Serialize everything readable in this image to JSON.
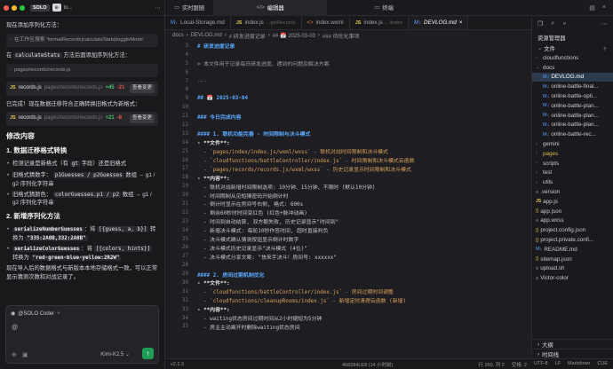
{
  "left_panel": {
    "header_title": "to...",
    "brand": "SOLO",
    "brand_icon": "⊕",
    "intro": "现在添加序列化方法：",
    "fileref1": "在工作区搜索 'formatRecords|calculateStats|toggleMode'",
    "intro2_a": "在 ",
    "intro2_code": "calculateStats",
    "intro2_b": " 方法后面添加序列化方法：",
    "fileref2": "pages/records/records.js",
    "edit1": {
      "file": "records.js",
      "path": "pages/records/records.js",
      "add": "+45",
      "del": "-21",
      "btn": "查看变更"
    },
    "edit2": {
      "file": "records.js",
      "path": "pages/records/records.js",
      "add": "+21",
      "del": "-8",
      "btn": "查看变更"
    },
    "done_text": "已完成！现在数据迁移符合正确转换旧格式为新格式：",
    "h_changes": "修改内容",
    "h1": "1. 数据迁移格式转换",
    "s1": [
      {
        "a": "检测记录是新格式（有 ",
        "code": "gt",
        "b": " 字段）还是旧格式"
      },
      {
        "a": "旧格式猜数字： ",
        "code": "p1Guesses / p2Guesses",
        "b": " 数组 → g1 / g2 序列化字符串"
      },
      {
        "a": "旧格式猜颜色： ",
        "code": "colorGuesses.p1 / p2",
        "b": " 数组 → g1 / g2 序列化字符串"
      }
    ],
    "h2": "2. 新增序列化方法",
    "s2": [
      {
        "code": "serializeNumberGuesses",
        "a": "：将 ",
        "code2": "[{guess, a, b}]",
        "b": " 转换为 ",
        "code3": "\"335:2A0B,332:2A0B\""
      },
      {
        "code": "serializeColorGuesses",
        "a": "：将 ",
        "code2": "[{colors, hints}]",
        "b": " 转换为 ",
        "code3": "\"red-green-blue-yellow:2R2W\""
      }
    ],
    "closing": "现在导入后的数据格式与新版本本地存储格式一致，可以正常显示猜测次数和对战记录了。",
    "composer": {
      "agent": "@SOLO Coder",
      "input": "@",
      "model": "Kimi-K2.5",
      "send": "↑"
    }
  },
  "topbar": {
    "tab_realtime": "实时跟随",
    "tab_editor": "编辑器",
    "tab_terminal": "终端"
  },
  "editor": {
    "tabs": [
      {
        "icon": "md",
        "name": "Local-Storage.md",
        "hint": ""
      },
      {
        "icon": "js",
        "name": "index.js",
        "hint": "...ge\\Records"
      },
      {
        "icon": "xml",
        "name": "index.wxml",
        "hint": ""
      },
      {
        "icon": "js",
        "name": "index.js",
        "hint": "...\\index"
      },
      {
        "icon": "md",
        "name": "DEVLOG.md",
        "hint": ""
      }
    ],
    "breadcrumbs": [
      "docs",
      "DEVLOG.md",
      "# 研发进度记录",
      "## 📅 2025-03-03",
      "### 待优化事项"
    ]
  },
  "code_lines": [
    {
      "n": "3",
      "t": "# 研发进度记录",
      "k": "h"
    },
    {
      "n": "4",
      "t": "",
      "k": ""
    },
    {
      "n": "5",
      "t": "> 本文件用于记录每日研发进度、遇到的问题及解决方案",
      "k": "q"
    },
    {
      "n": "6",
      "t": "",
      "k": ""
    },
    {
      "n": "7",
      "t": "---",
      "k": "q"
    },
    {
      "n": "8",
      "t": "",
      "k": ""
    },
    {
      "n": "9",
      "t": "## 📅 2025-03-04",
      "k": "h"
    },
    {
      "n": "10",
      "t": "",
      "k": ""
    },
    {
      "n": "11",
      "t": "### 今日完成内容",
      "k": "h"
    },
    {
      "n": "12",
      "t": "",
      "k": ""
    },
    {
      "n": "13",
      "t": "#### 1. 联机功能完善 - 时间限制与决斗模式",
      "k": "h"
    },
    {
      "n": "14",
      "t": "- **文件**:",
      "k": "b"
    },
    {
      "n": "15",
      "t": "  - `pages/index/index.js/wxml/wxss` - 联机对战时间限制和决斗模式",
      "k": "c"
    },
    {
      "n": "16",
      "t": "  - `cloudfunctions/battleController/index.js` - 时间限制和决斗模式云函数",
      "k": "c"
    },
    {
      "n": "17",
      "t": "  - `pages/records/records.js/wxml/wxss` - 历史记录显示时间限制和决斗模式",
      "k": "c"
    },
    {
      "n": "18",
      "t": "- **内容**:",
      "k": "b"
    },
    {
      "n": "19",
      "t": "  - 联机对战新增时间限制选项: 10分钟、15分钟、不限时 (默认10分钟)",
      "k": ""
    },
    {
      "n": "20",
      "t": "  - 时间限制从见短猜密码开始倒计时",
      "k": ""
    },
    {
      "n": "21",
      "t": "  - 倒计时显示在房间号右侧, 格式: 600s",
      "k": ""
    },
    {
      "n": "22",
      "t": "  - 剩余60秒时时间变红色 (红色+脉冲动画)",
      "k": ""
    },
    {
      "n": "23",
      "t": "  - 时间到自动结算, 双方都失败, 历史记录显示\"时间到\"",
      "k": ""
    },
    {
      "n": "24",
      "t": "  - 新增决斗模式: 每轮10秒作答时间, 超时直接判负",
      "k": ""
    },
    {
      "n": "25",
      "t": "  - 决斗模式确认猜测按钮显示倒计时数字",
      "k": ""
    },
    {
      "n": "26",
      "t": "  - 决斗模式历史记录显示\"决斗模式 (4位)\"",
      "k": ""
    },
    {
      "n": "27",
      "t": "  - 决斗模式分享文案: \"快来手决斗！房间号: xxxxxx\"",
      "k": ""
    },
    {
      "n": "28",
      "t": "",
      "k": ""
    },
    {
      "n": "29",
      "t": "#### 2. 房间过期机制优化",
      "k": "h"
    },
    {
      "n": "30",
      "t": "- **文件**:",
      "k": "b"
    },
    {
      "n": "31",
      "t": "  - `cloudfunctions/battleController/index.js` - 房间过期时间调整",
      "k": "c"
    },
    {
      "n": "32",
      "t": "  - `cloudfunctions/cleanupRooms/index.js` - 新增定时清理云函数 (新增)",
      "k": "c"
    },
    {
      "n": "33",
      "t": "- **内容**:",
      "k": "b"
    },
    {
      "n": "34",
      "t": "  - waiting状态房间过期时间从2小时缩短为5分钟",
      "k": ""
    },
    {
      "n": "35",
      "t": "  - 房主主动离开时删除waiting状态房间",
      "k": ""
    }
  ],
  "status": {
    "left": "v2.2.3",
    "cursor": "468284LE8 (14 小时前)",
    "pos": "行 260, 列 2",
    "spaces": "空格: 2",
    "enc": "UTF-8",
    "eol": "LF",
    "lang": "Markdown",
    "cue": "CUE"
  },
  "explorer": {
    "title": "资源管理器",
    "root": "文件",
    "items": [
      {
        "name": "cloudfunctions",
        "type": "folder",
        "level": 1,
        "open": false
      },
      {
        "name": "docs",
        "type": "folder",
        "level": 1,
        "open": true
      },
      {
        "name": "DEVLOG.md",
        "type": "md",
        "level": 2,
        "sel": true
      },
      {
        "name": "online-battle-final...",
        "type": "md",
        "level": 2
      },
      {
        "name": "online-battle-opti...",
        "type": "md",
        "level": 2
      },
      {
        "name": "online-battle-plan...",
        "type": "md",
        "level": 2
      },
      {
        "name": "online-battle-plan...",
        "type": "md",
        "level": 2
      },
      {
        "name": "online-battle-plan...",
        "type": "md",
        "level": 2
      },
      {
        "name": "online-battle-rec...",
        "type": "md",
        "level": 2
      },
      {
        "name": "gemini",
        "type": "folder",
        "level": 1
      },
      {
        "name": "pages",
        "type": "folder",
        "level": 1,
        "yellow": true
      },
      {
        "name": "scripts",
        "type": "folder",
        "level": 1
      },
      {
        "name": "test",
        "type": "folder",
        "level": 1
      },
      {
        "name": "utils",
        "type": "folder",
        "level": 1
      },
      {
        "name": ".version",
        "type": "cfg",
        "level": 1
      },
      {
        "name": "app.js",
        "type": "js",
        "level": 1
      },
      {
        "name": "app.json",
        "type": "json",
        "level": 1
      },
      {
        "name": "app.wxss",
        "type": "cfg",
        "level": 1
      },
      {
        "name": "project.config.json",
        "type": "json",
        "level": 1
      },
      {
        "name": "project.private.confi...",
        "type": "json",
        "level": 1
      },
      {
        "name": "README.md",
        "type": "md",
        "level": 1
      },
      {
        "name": "sitemap.json",
        "type": "json",
        "level": 1
      },
      {
        "name": "upload.sh",
        "type": "cfg",
        "level": 1
      },
      {
        "name": "Victor-color",
        "type": "cfg",
        "level": 1
      }
    ],
    "bottom": [
      "大纲",
      "时间线"
    ]
  },
  "colors": {
    "accent": "#1f9d57",
    "selection": "#2d3a4e",
    "heading": "#5aa9ff"
  }
}
